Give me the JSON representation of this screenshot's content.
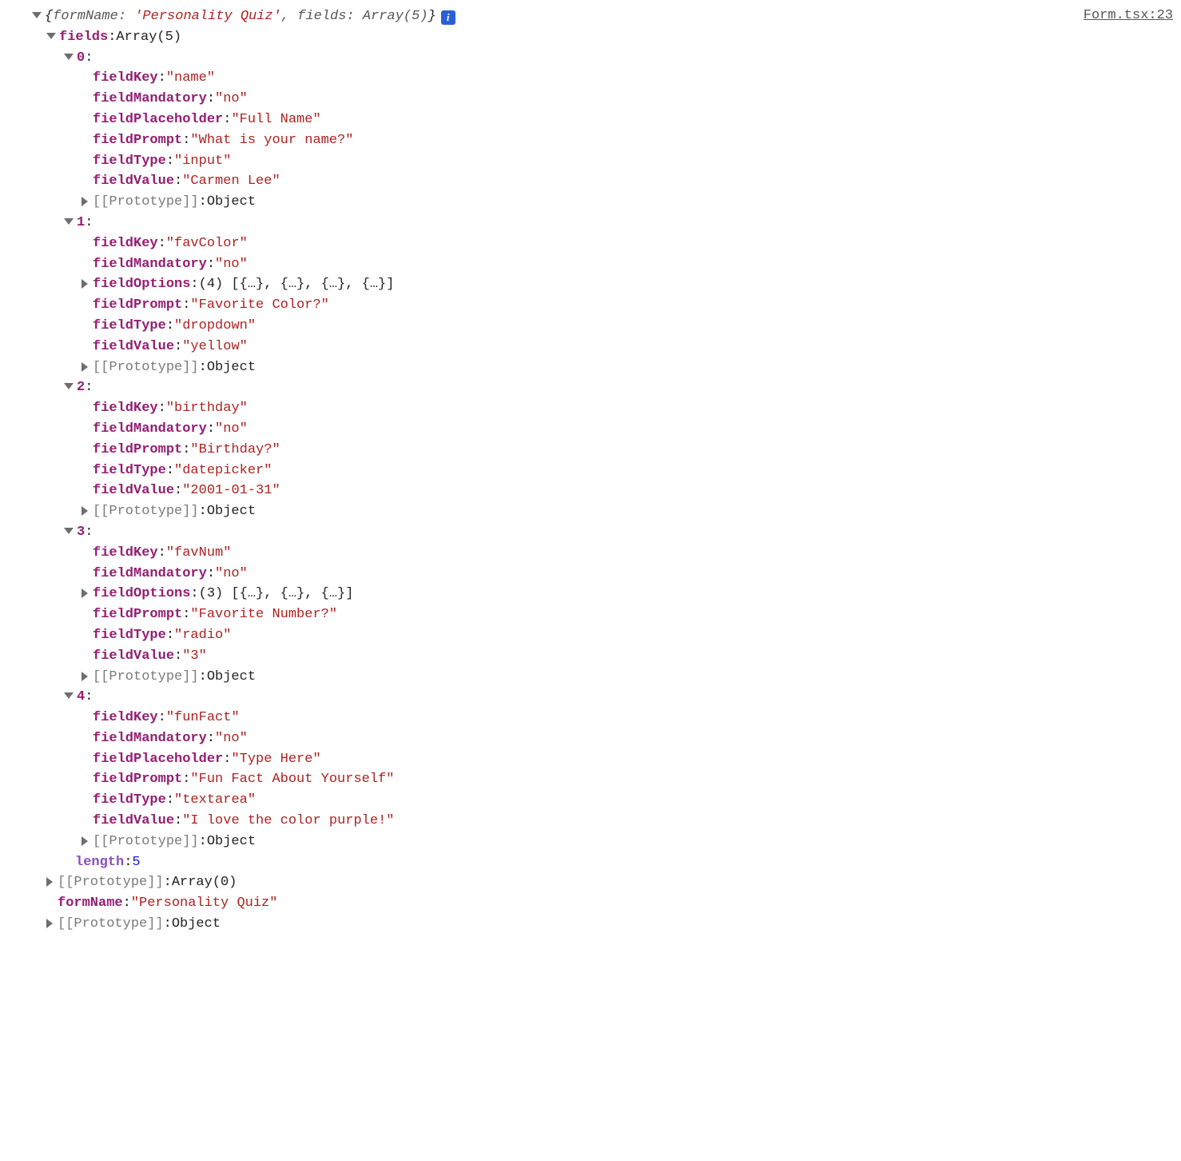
{
  "sourceLink": "Form.tsx:23",
  "summary": {
    "open": "{",
    "formNameKey": "formName: ",
    "formNameVal": "'Personality Quiz'",
    "sep": ", ",
    "fieldsKey": "fields: ",
    "fieldsVal": "Array(5)",
    "close": "}"
  },
  "root": {
    "fieldsLabel": "fields",
    "fieldsType": "Array(5)",
    "items": [
      {
        "idx": "0",
        "props": [
          {
            "k": "fieldKey",
            "v": "\"name\"",
            "t": "str"
          },
          {
            "k": "fieldMandatory",
            "v": "\"no\"",
            "t": "str"
          },
          {
            "k": "fieldPlaceholder",
            "v": "\"Full Name\"",
            "t": "str"
          },
          {
            "k": "fieldPrompt",
            "v": "\"What is your name?\"",
            "t": "str"
          },
          {
            "k": "fieldType",
            "v": "\"input\"",
            "t": "str"
          },
          {
            "k": "fieldValue",
            "v": "\"Carmen Lee\"",
            "t": "str"
          }
        ],
        "proto": "[[Prototype]]",
        "protoVal": "Object"
      },
      {
        "idx": "1",
        "props": [
          {
            "k": "fieldKey",
            "v": "\"favColor\"",
            "t": "str"
          },
          {
            "k": "fieldMandatory",
            "v": "\"no\"",
            "t": "str"
          },
          {
            "k": "fieldOptions",
            "v": "(4) [{…}, {…}, {…}, {…}]",
            "t": "obj",
            "expandable": true
          },
          {
            "k": "fieldPrompt",
            "v": "\"Favorite Color?\"",
            "t": "str"
          },
          {
            "k": "fieldType",
            "v": "\"dropdown\"",
            "t": "str"
          },
          {
            "k": "fieldValue",
            "v": "\"yellow\"",
            "t": "str"
          }
        ],
        "proto": "[[Prototype]]",
        "protoVal": "Object"
      },
      {
        "idx": "2",
        "props": [
          {
            "k": "fieldKey",
            "v": "\"birthday\"",
            "t": "str"
          },
          {
            "k": "fieldMandatory",
            "v": "\"no\"",
            "t": "str"
          },
          {
            "k": "fieldPrompt",
            "v": "\"Birthday?\"",
            "t": "str"
          },
          {
            "k": "fieldType",
            "v": "\"datepicker\"",
            "t": "str"
          },
          {
            "k": "fieldValue",
            "v": "\"2001-01-31\"",
            "t": "str"
          }
        ],
        "proto": "[[Prototype]]",
        "protoVal": "Object"
      },
      {
        "idx": "3",
        "props": [
          {
            "k": "fieldKey",
            "v": "\"favNum\"",
            "t": "str"
          },
          {
            "k": "fieldMandatory",
            "v": "\"no\"",
            "t": "str"
          },
          {
            "k": "fieldOptions",
            "v": "(3) [{…}, {…}, {…}]",
            "t": "obj",
            "expandable": true
          },
          {
            "k": "fieldPrompt",
            "v": "\"Favorite Number?\"",
            "t": "str"
          },
          {
            "k": "fieldType",
            "v": "\"radio\"",
            "t": "str"
          },
          {
            "k": "fieldValue",
            "v": "\"3\"",
            "t": "str"
          }
        ],
        "proto": "[[Prototype]]",
        "protoVal": "Object"
      },
      {
        "idx": "4",
        "props": [
          {
            "k": "fieldKey",
            "v": "\"funFact\"",
            "t": "str"
          },
          {
            "k": "fieldMandatory",
            "v": "\"no\"",
            "t": "str"
          },
          {
            "k": "fieldPlaceholder",
            "v": "\"Type Here\"",
            "t": "str"
          },
          {
            "k": "fieldPrompt",
            "v": "\"Fun Fact About Yourself\"",
            "t": "str"
          },
          {
            "k": "fieldType",
            "v": "\"textarea\"",
            "t": "str"
          },
          {
            "k": "fieldValue",
            "v": "\"I love the color purple!\"",
            "t": "str"
          }
        ],
        "proto": "[[Prototype]]",
        "protoVal": "Object"
      }
    ],
    "lengthKey": "length",
    "lengthVal": "5",
    "arrProto": "[[Prototype]]",
    "arrProtoVal": "Array(0)",
    "formNameKey": "formName",
    "formNameVal": "\"Personality Quiz\"",
    "objProto": "[[Prototype]]",
    "objProtoVal": "Object"
  }
}
